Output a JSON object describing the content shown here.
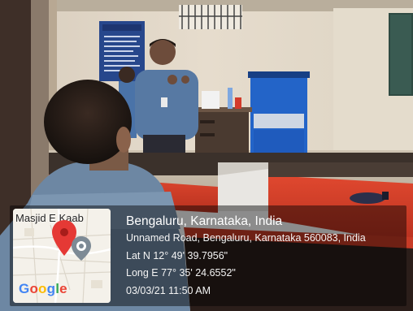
{
  "map": {
    "place_label": "Masjid E Kaab",
    "brand": [
      "G",
      "o",
      "o",
      "g",
      "l",
      "e"
    ],
    "brand_colors": [
      "#4285F4",
      "#EA4335",
      "#FBBC05",
      "#4285F4",
      "#34A853",
      "#EA4335"
    ],
    "pin_color": "#E53935",
    "icon": "location-pin-icon"
  },
  "geotag": {
    "city": "Bengaluru, Karnataka, India",
    "address": "Unnamed Road, Bengaluru, Karnataka 560083, India",
    "latitude": "Lat N 12° 49' 39.7956\"",
    "longitude": "Long E 77° 35' 24.6552\"",
    "datetime": "03/03/21 11:50 AM"
  }
}
